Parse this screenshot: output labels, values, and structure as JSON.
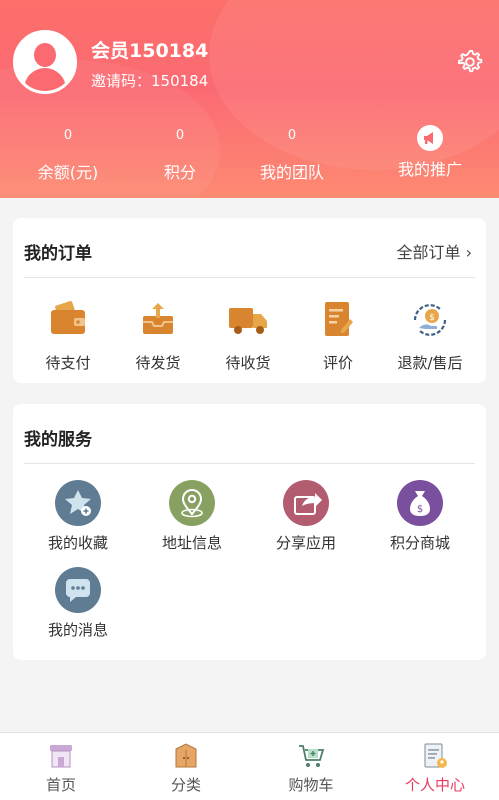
{
  "user": {
    "name": "会员150184",
    "invite": "邀请码：150184"
  },
  "stats": [
    {
      "value": "0",
      "label": "余额(元)"
    },
    {
      "value": "0",
      "label": "积分"
    },
    {
      "value": "0",
      "label": "我的团队"
    },
    {
      "value": "",
      "label": "我的推广",
      "icon": "megaphone-icon"
    }
  ],
  "orders": {
    "title": "我的订单",
    "all_link": "全部订单",
    "items": [
      {
        "label": "待支付",
        "icon": "wallet-icon"
      },
      {
        "label": "待发货",
        "icon": "upload-box-icon"
      },
      {
        "label": "待收货",
        "icon": "truck-icon"
      },
      {
        "label": "评价",
        "icon": "document-edit-icon"
      },
      {
        "label": "退款/售后",
        "icon": "refund-icon"
      }
    ]
  },
  "services": {
    "title": "我的服务",
    "items": [
      {
        "label": "我的收藏",
        "icon": "star-icon",
        "color": "#5f7c93"
      },
      {
        "label": "地址信息",
        "icon": "location-pin-icon",
        "color": "#88a162"
      },
      {
        "label": "分享应用",
        "icon": "share-icon",
        "color": "#b35c6f"
      },
      {
        "label": "积分商城",
        "icon": "money-bag-icon",
        "color": "#7a4f9d"
      },
      {
        "label": "我的消息",
        "icon": "chat-bubble-icon",
        "color": "#5f7c93"
      }
    ]
  },
  "tabbar": [
    {
      "label": "首页",
      "icon": "storefront-icon"
    },
    {
      "label": "分类",
      "icon": "wardrobe-icon"
    },
    {
      "label": "购物车",
      "icon": "cart-icon"
    },
    {
      "label": "个人中心",
      "icon": "profile-doc-icon",
      "active": true
    }
  ],
  "colors": {
    "header_start": "#fc6f6a",
    "header_end": "#fd8a72",
    "accent": "#ec3a62"
  }
}
